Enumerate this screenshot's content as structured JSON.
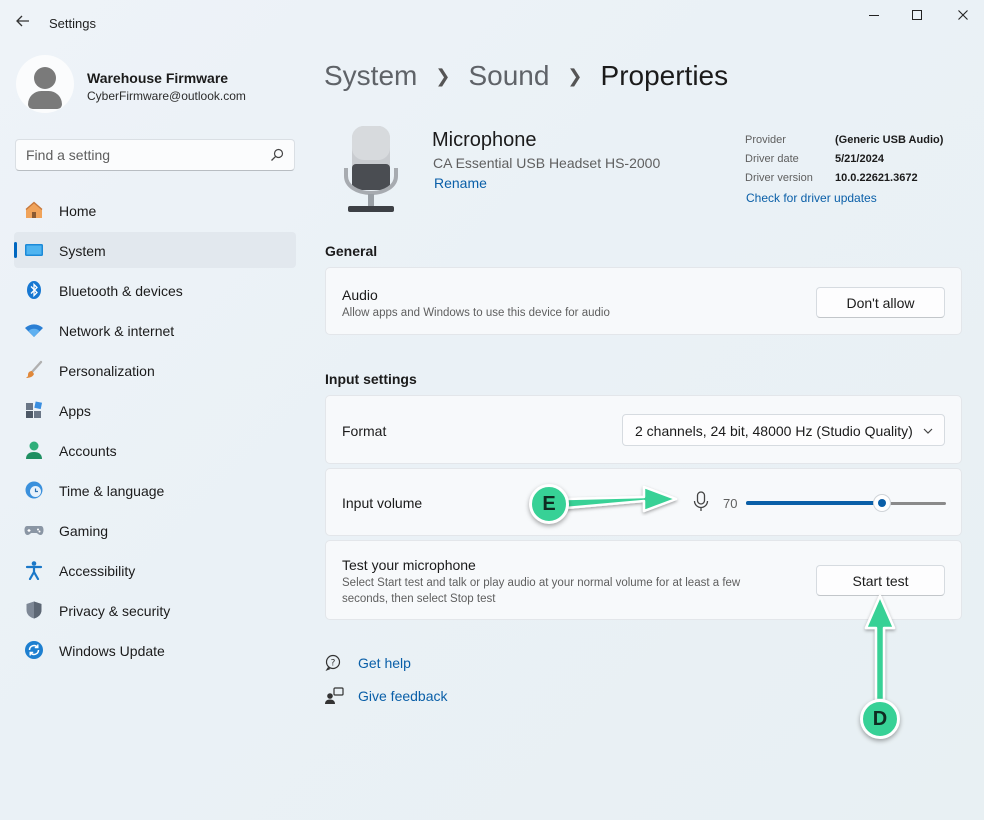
{
  "window": {
    "title": "Settings",
    "controls": {
      "minimize": "minimize-icon",
      "maximize": "maximize-icon",
      "close": "close-icon"
    }
  },
  "profile": {
    "name": "Warehouse Firmware",
    "email": "CyberFirmware@outlook.com"
  },
  "search": {
    "placeholder": "Find a setting"
  },
  "sidebar": {
    "items": [
      {
        "label": "Home",
        "icon": "home-icon",
        "active": false
      },
      {
        "label": "System",
        "icon": "system-icon",
        "active": true
      },
      {
        "label": "Bluetooth & devices",
        "icon": "bluetooth-icon",
        "active": false
      },
      {
        "label": "Network & internet",
        "icon": "wifi-icon",
        "active": false
      },
      {
        "label": "Personalization",
        "icon": "brush-icon",
        "active": false
      },
      {
        "label": "Apps",
        "icon": "apps-icon",
        "active": false
      },
      {
        "label": "Accounts",
        "icon": "accounts-icon",
        "active": false
      },
      {
        "label": "Time & language",
        "icon": "clock-globe-icon",
        "active": false
      },
      {
        "label": "Gaming",
        "icon": "gamepad-icon",
        "active": false
      },
      {
        "label": "Accessibility",
        "icon": "accessibility-icon",
        "active": false
      },
      {
        "label": "Privacy & security",
        "icon": "shield-icon",
        "active": false
      },
      {
        "label": "Windows Update",
        "icon": "update-icon",
        "active": false
      }
    ]
  },
  "breadcrumb": {
    "items": [
      "System",
      "Sound"
    ],
    "current": "Properties"
  },
  "device": {
    "name": "Microphone",
    "model": "CA Essential USB Headset HS-2000",
    "rename_label": "Rename"
  },
  "driver": {
    "provider_label": "Provider",
    "provider_value": "(Generic USB Audio)",
    "date_label": "Driver date",
    "date_value": "5/21/2024",
    "version_label": "Driver version",
    "version_value": "10.0.22621.3672",
    "check_updates_label": "Check for driver updates"
  },
  "general": {
    "title": "General",
    "audio": {
      "title": "Audio",
      "description": "Allow apps and Windows to use this device for audio",
      "button_label": "Don't allow"
    }
  },
  "input_settings": {
    "title": "Input settings",
    "format": {
      "label": "Format",
      "value": "2 channels, 24 bit, 48000 Hz (Studio Quality)"
    },
    "volume": {
      "label": "Input volume",
      "value": "70",
      "level_percent": 68
    },
    "test": {
      "title": "Test your microphone",
      "description_line1": "Select Start test and talk or play audio at your normal volume for at least a few",
      "description_line2": "seconds, then select Stop test",
      "button_label": "Start test"
    }
  },
  "help": {
    "get_help": "Get help",
    "give_feedback": "Give feedback"
  },
  "annotations": {
    "callout_e": "E",
    "callout_d": "D",
    "color": "#37d196"
  },
  "colors": {
    "accent": "#0067c0",
    "link": "#0a5fa8",
    "callout_green": "#37d196"
  }
}
